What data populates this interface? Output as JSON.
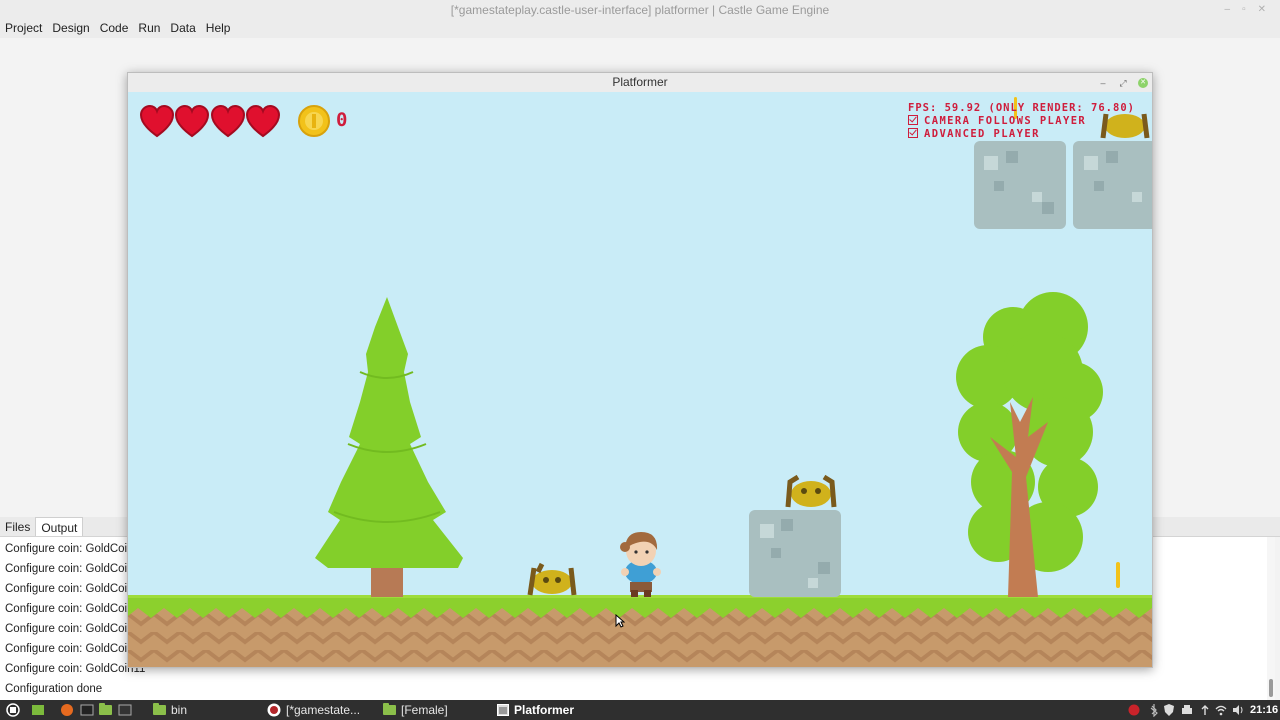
{
  "editor": {
    "title": "[*gamestateplay.castle-user-interface] platformer | Castle Game Engine",
    "menu": [
      "Project",
      "Design",
      "Code",
      "Run",
      "Data",
      "Help"
    ]
  },
  "bottom_panel": {
    "tabs": [
      "Files",
      "Output"
    ],
    "active_tab": "Output",
    "output_lines": [
      "Configure coin: GoldCoi",
      "Configure coin: GoldCoi",
      "Configure coin: GoldCoi",
      "Configure coin: GoldCoi",
      "Configure coin: GoldCoi",
      "Configure coin: GoldCoi",
      "Configure coin: GoldCoin11",
      "Configuration done"
    ]
  },
  "game_window": {
    "title": "Platformer",
    "hud": {
      "lives": 4,
      "coin_count": "0",
      "fps_text": "FPS: 59.92 (ONLY RENDER: 76.80)",
      "options": [
        "CAMERA FOLLOWS PLAYER",
        "ADVANCED PLAYER"
      ]
    }
  },
  "taskbar": {
    "items": [
      {
        "label": "bin",
        "icon": "folder-icon"
      },
      {
        "label": "[*gamestate...",
        "icon": "castle-engine-icon"
      },
      {
        "label": "[Female]",
        "icon": "folder-icon"
      },
      {
        "label": "Platformer",
        "icon": "window-icon"
      }
    ],
    "clock": "21:16"
  },
  "colors": {
    "sky": "#c9ecf7",
    "grass": "#8cd02d",
    "dirt": "#c79a6b",
    "hud_red": "#cf1d3c",
    "coin": "#f2c21a"
  }
}
